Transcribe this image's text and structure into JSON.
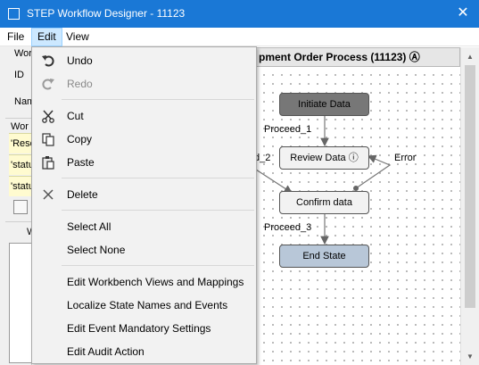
{
  "window": {
    "title": "STEP Workflow Designer - 11123",
    "close_glyph": "✕"
  },
  "menubar": {
    "file": "File",
    "edit": "Edit",
    "view": "View"
  },
  "left_panel": {
    "label_work": "Work",
    "label_id": "ID",
    "label_name": "Nam",
    "label_work2": "Wor",
    "rows": [
      "'Reso",
      "'statu",
      "'statu"
    ],
    "label_w": "W"
  },
  "diagram": {
    "header": "pment Order Process (11123) Ⓐ",
    "nodes": {
      "initiate": "Initiate Data",
      "review": "Review Data ⓘ",
      "confirm": "Confirm data",
      "end": "End State"
    },
    "edges": {
      "proceed1": "Proceed_1",
      "proceed2": "d_2",
      "error": "Error",
      "proceed3": "Proceed_3"
    },
    "colors": {
      "initiate_fill": "#777777",
      "review_fill": "#f2f2f2",
      "confirm_fill": "#f2f2f2",
      "end_fill": "#b8c7d8"
    }
  },
  "edit_menu": {
    "undo": "Undo",
    "redo": "Redo",
    "cut": "Cut",
    "copy": "Copy",
    "paste": "Paste",
    "delete": "Delete",
    "select_all": "Select All",
    "select_none": "Select None",
    "edit_views": "Edit Workbench Views and Mappings",
    "localize": "Localize State Names and Events",
    "mandatory": "Edit Event Mandatory Settings",
    "audit": "Edit Audit Action"
  },
  "colors": {
    "titlebar": "#1a78d6",
    "menu_active": "#cce8ff",
    "menu_bg": "#f2f2f2"
  }
}
